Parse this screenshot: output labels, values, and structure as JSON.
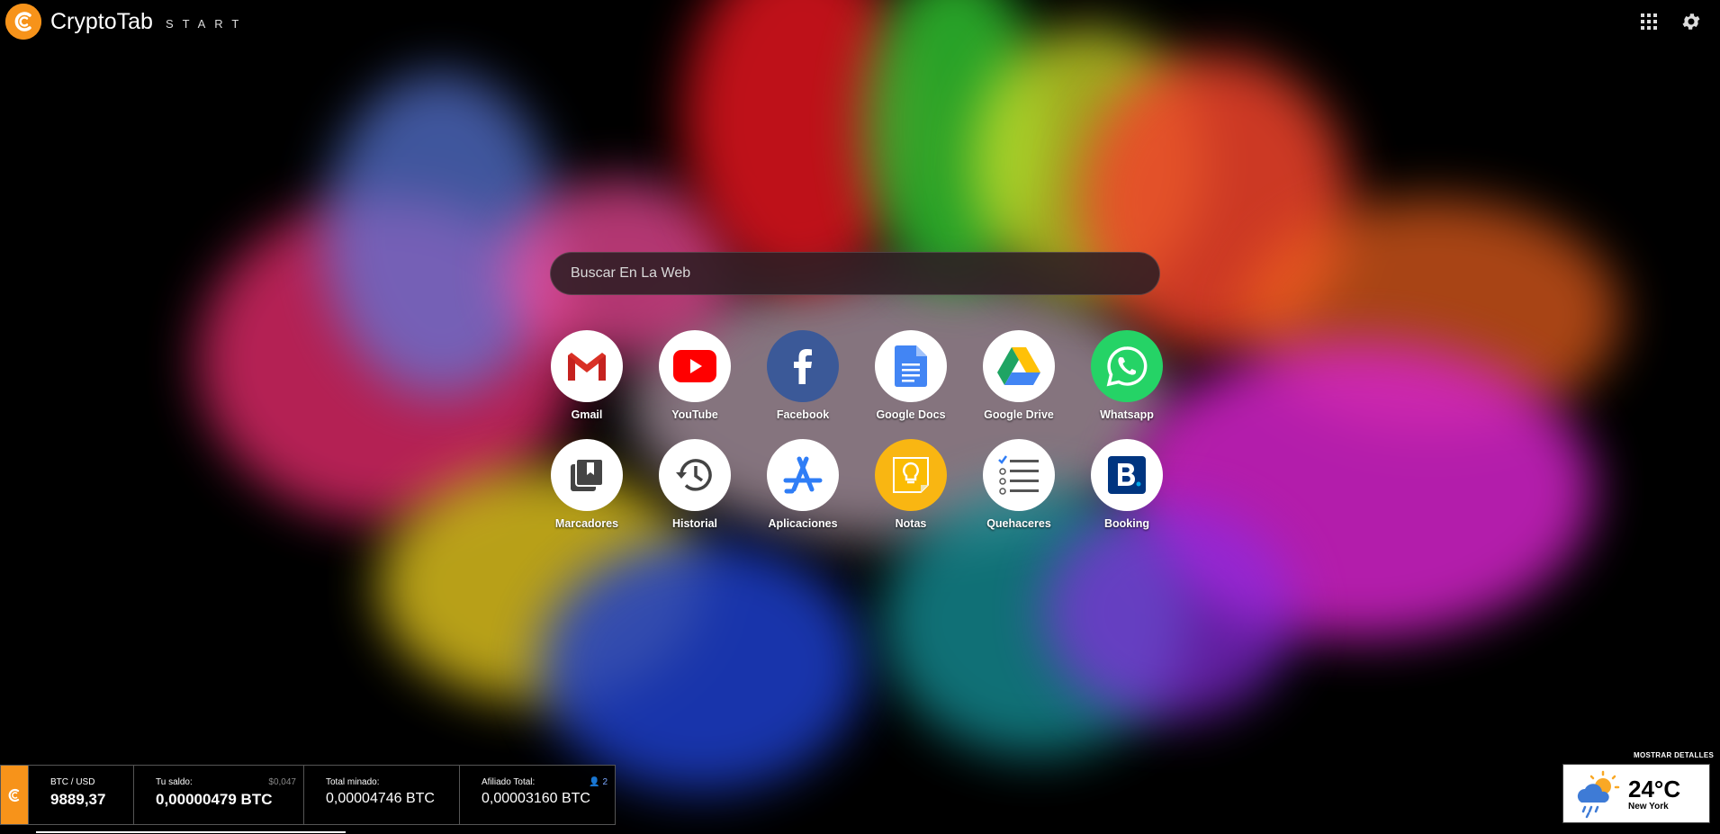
{
  "header": {
    "brand": "CryptoTab",
    "sub": "START",
    "badge_glyph": "C"
  },
  "search": {
    "placeholder": "Buscar En La Web"
  },
  "tiles": [
    {
      "label": "Gmail",
      "icon": "gmail-icon"
    },
    {
      "label": "YouTube",
      "icon": "youtube-icon"
    },
    {
      "label": "Facebook",
      "icon": "facebook-icon"
    },
    {
      "label": "Google Docs",
      "icon": "google-docs-icon"
    },
    {
      "label": "Google Drive",
      "icon": "google-drive-icon"
    },
    {
      "label": "Whatsapp",
      "icon": "whatsapp-icon"
    },
    {
      "label": "Marcadores",
      "icon": "bookmarks-icon"
    },
    {
      "label": "Historial",
      "icon": "history-icon"
    },
    {
      "label": "Aplicaciones",
      "icon": "app-store-icon"
    },
    {
      "label": "Notas",
      "icon": "notes-icon"
    },
    {
      "label": "Quehaceres",
      "icon": "todo-list-icon"
    },
    {
      "label": "Booking",
      "icon": "booking-icon"
    }
  ],
  "stats": {
    "pair_label": "BTC / USD",
    "pair_value": "9889,37",
    "balance_label": "Tu saldo:",
    "balance_value": "0,00000479 BTC",
    "balance_usd": "$0,047",
    "mined_label": "Total minado:",
    "mined_value": "0,00004746 BTC",
    "affiliate_label": "Afiliado Total:",
    "affiliate_value": "0,00003160 BTC",
    "affiliate_count": "2"
  },
  "weather": {
    "details_link": "MOSTRAR DETALLES",
    "temp": "24°C",
    "city": "New York",
    "icon": "partly-cloudy-rain-icon"
  },
  "colors": {
    "brand_orange": "#f7931a",
    "facebook": "#3b5998",
    "whatsapp": "#25d366",
    "notes": "#f9b612",
    "booking": "#003580"
  }
}
